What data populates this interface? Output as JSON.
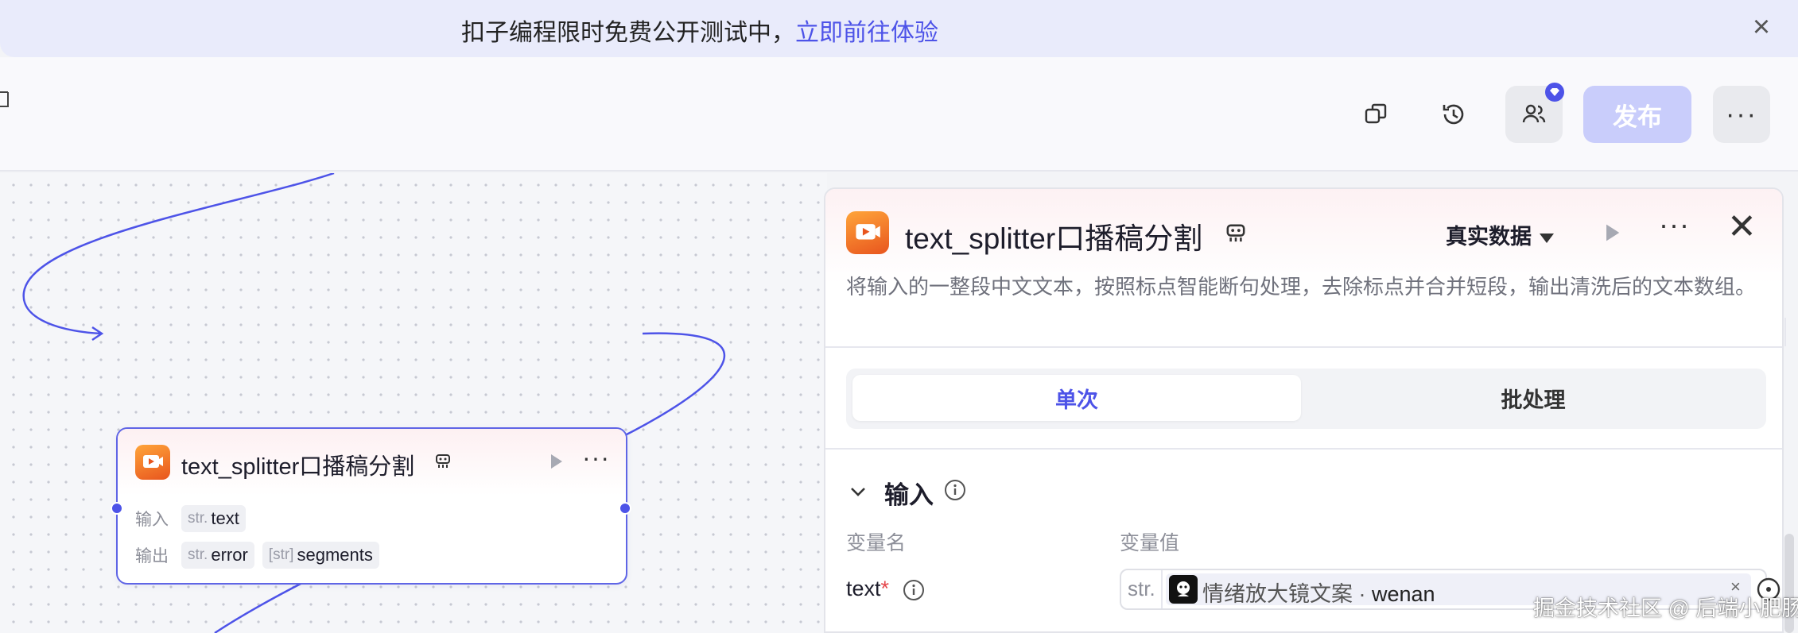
{
  "banner": {
    "text": "扣子编程限时免费公开测试中，",
    "link": "立即前往体验"
  },
  "toolbar": {
    "publish_label": "发布"
  },
  "node": {
    "title": "text_splitter口播稿分割",
    "input_label": "输入",
    "output_label": "输出",
    "inputs": [
      {
        "type": "str.",
        "name": "text"
      }
    ],
    "outputs": [
      {
        "type": "str.",
        "name": "error"
      },
      {
        "type": "[str]",
        "name": "segments"
      }
    ]
  },
  "panel": {
    "title": "text_splitter口播稿分割",
    "data_mode": "真实数据",
    "description": "将输入的一整段中文文本，按照标点智能断句处理，去除标点并合并短段，输出清洗后的文本数组。",
    "tabs": [
      "单次",
      "批处理"
    ],
    "section_title": "输入",
    "col_name": "变量名",
    "col_value": "变量值",
    "var": {
      "name": "text",
      "required_mark": "*",
      "type": "str.",
      "source": "情绪放大镜文案",
      "separator": " · ",
      "field": "wenan"
    }
  },
  "watermark": "掘金技术社区 @ 后端小肥肠",
  "colors": {
    "accent": "#4d53e8",
    "publish_disabled": "#c9cdfb",
    "banner_bg": "#e9ebfb"
  }
}
